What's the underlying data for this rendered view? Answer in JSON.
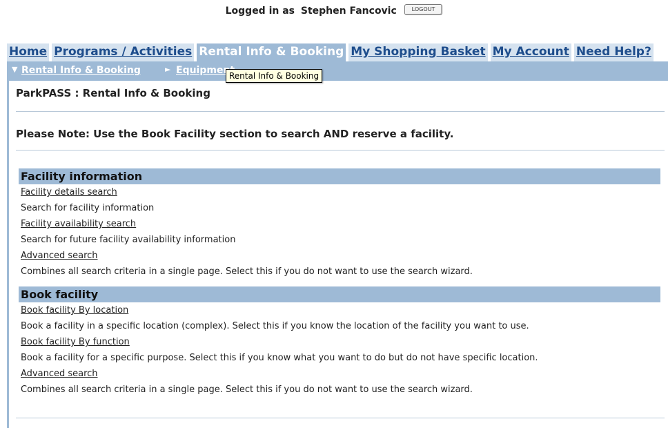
{
  "topbar": {
    "logged_in_label": "Logged in as",
    "user_name": "Stephen Fancovic",
    "logout_label": "LOGOUT"
  },
  "tabs": [
    {
      "label": "Home"
    },
    {
      "label": "Programs / Activities"
    },
    {
      "label": "Rental Info & Booking"
    },
    {
      "label": "My Shopping Basket"
    },
    {
      "label": "My Account"
    },
    {
      "label": "Need Help?"
    }
  ],
  "subnav": {
    "current": "Rental Info & Booking",
    "next": "Equipment"
  },
  "tooltip": "Rental Info & Booking",
  "page": {
    "title": "ParkPASS : Rental Info & Booking",
    "note": "Please Note: Use the Book Facility section to search AND reserve a facility."
  },
  "sections": [
    {
      "header": "Facility information",
      "items": [
        {
          "link": "Facility details search",
          "desc": "Search for facility information"
        },
        {
          "link": "Facility availability search",
          "desc": "Search for future facility availability information"
        },
        {
          "link": "Advanced search",
          "desc": "Combines all search criteria in a single page. Select this if you do not want to use the search wizard."
        }
      ]
    },
    {
      "header": "Book facility",
      "items": [
        {
          "link": "Book facility By location",
          "desc": "Book a facility in a specific location (complex). Select this if you know the location of the facility you want to use."
        },
        {
          "link": "Book facility By function",
          "desc": "Book a facility for a specific purpose. Select this if you know what you want to do but do not have specific location."
        },
        {
          "link": "Advanced search",
          "desc": "Combines all search criteria in a single page. Select this if you do not want to use the search wizard."
        }
      ]
    }
  ],
  "colors": {
    "tab_bg": "#d5e2ef",
    "tab_active_bg": "#9ebad6",
    "tab_text": "#1e4d8c",
    "section_header_bg": "#9ebad6",
    "tooltip_bg": "#ffffe1"
  }
}
